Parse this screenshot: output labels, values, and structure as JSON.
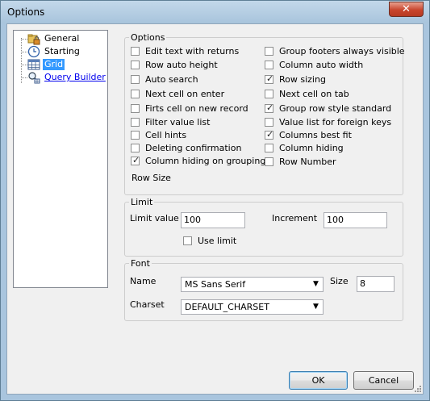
{
  "window": {
    "title": "Options",
    "close_glyph": "✕"
  },
  "tree": {
    "items": [
      {
        "label": "General",
        "icon": "folder-lock-icon"
      },
      {
        "label": "Starting",
        "icon": "clock-icon"
      },
      {
        "label": "Grid",
        "icon": "grid-icon",
        "selected": true
      },
      {
        "label": "Query Builder",
        "icon": "query-builder-icon",
        "link": true
      }
    ]
  },
  "options": {
    "legend": "Options",
    "left": [
      {
        "label": "Edit text with returns",
        "checked": false
      },
      {
        "label": "Row auto height",
        "checked": false
      },
      {
        "label": "Auto search",
        "checked": false
      },
      {
        "label": "Next cell on enter",
        "checked": false
      },
      {
        "label": "Firts cell on new record",
        "checked": false
      },
      {
        "label": "Filter value list",
        "checked": false
      },
      {
        "label": "Cell hints",
        "checked": false
      },
      {
        "label": "Deleting confirmation",
        "checked": false
      },
      {
        "label": "Column hiding on grouping",
        "checked": true
      }
    ],
    "right": [
      {
        "label": "Group footers always visible",
        "checked": false
      },
      {
        "label": "Column auto width",
        "checked": false
      },
      {
        "label": "Row sizing",
        "checked": true
      },
      {
        "label": "Next cell on tab",
        "checked": false
      },
      {
        "label": "Group row style standard",
        "checked": true
      },
      {
        "label": "Value list for foreign keys",
        "checked": false
      },
      {
        "label": "Columns best fit",
        "checked": true
      },
      {
        "label": "Column hiding",
        "checked": false
      },
      {
        "label": "Row Number",
        "checked": false
      }
    ],
    "row_size_label": "Row Size"
  },
  "limit": {
    "legend": "Limit",
    "limit_value_label": "Limit value",
    "limit_value": "100",
    "increment_label": "Increment",
    "increment_value": "100",
    "use_limit_label": "Use limit",
    "use_limit_checked": false
  },
  "font": {
    "legend": "Font",
    "name_label": "Name",
    "name_value": "MS Sans Serif",
    "size_label": "Size",
    "size_value": "8",
    "charset_label": "Charset",
    "charset_value": "DEFAULT_CHARSET"
  },
  "buttons": {
    "ok": "OK",
    "cancel": "Cancel"
  },
  "colors": {
    "selection": "#3399ff",
    "link": "#0000ee",
    "titlebar": "#a9c5de",
    "close": "#c8452d"
  }
}
